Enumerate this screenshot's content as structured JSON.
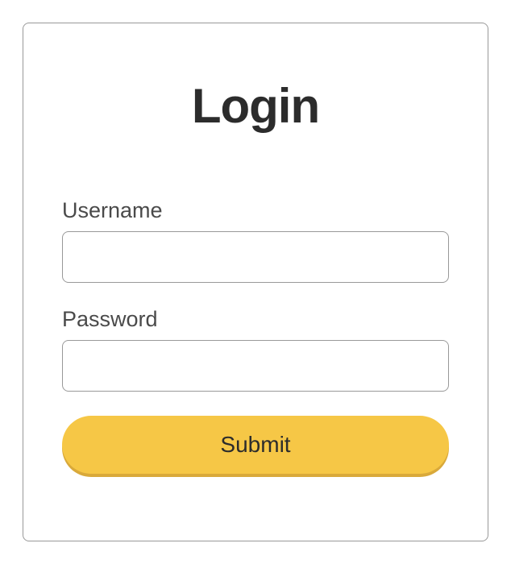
{
  "form": {
    "title": "Login",
    "username": {
      "label": "Username",
      "value": ""
    },
    "password": {
      "label": "Password",
      "value": ""
    },
    "submit_label": "Submit"
  },
  "colors": {
    "accent": "#f6c746",
    "accent_shadow": "#d9a93a",
    "border": "#999999",
    "text_dark": "#2c2c2c",
    "text_label": "#4a4a4a"
  }
}
